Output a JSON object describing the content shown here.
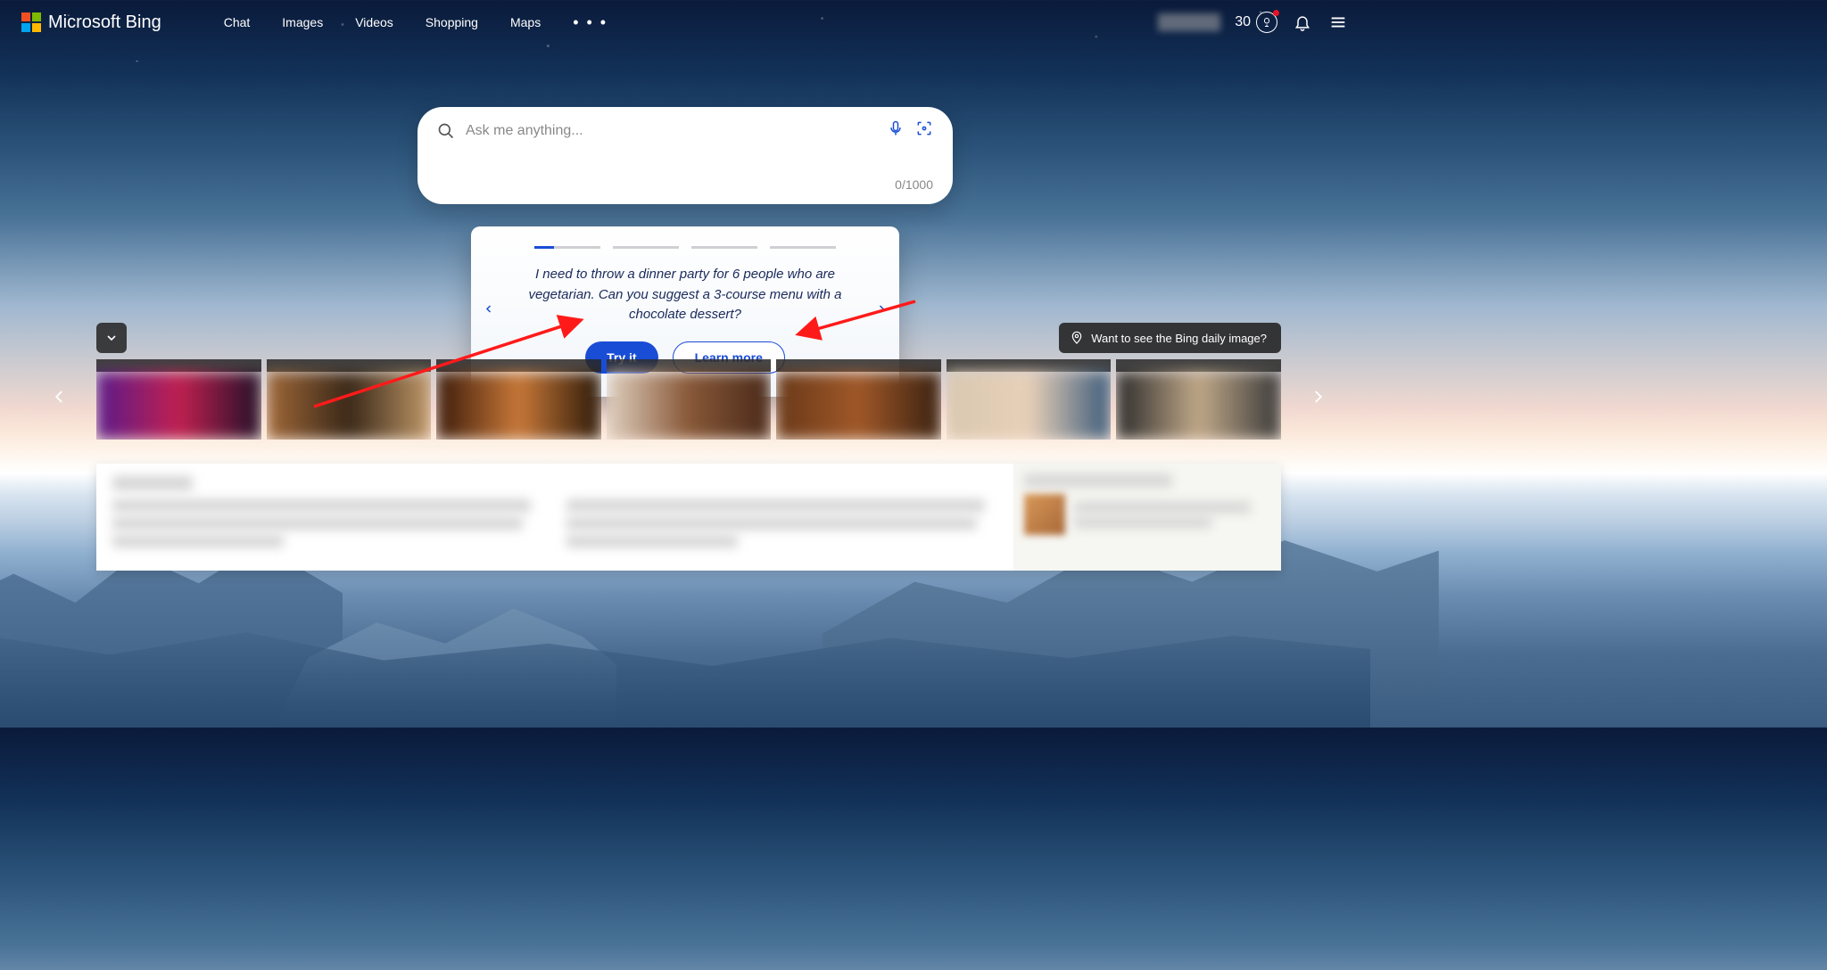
{
  "brand": {
    "name": "Microsoft Bing"
  },
  "nav": {
    "chat": "Chat",
    "images": "Images",
    "videos": "Videos",
    "shopping": "Shopping",
    "maps": "Maps"
  },
  "rewards": {
    "points": "30"
  },
  "search": {
    "placeholder": "Ask me anything...",
    "counter": "0/1000"
  },
  "promo": {
    "text": "I need to throw a dinner party for 6 people who are vegetarian. Can you suggest a 3-course menu with a chocolate dessert?",
    "try_label": "Try it",
    "learn_label": "Learn more"
  },
  "daily": {
    "label": "Want to see the Bing daily image?"
  }
}
